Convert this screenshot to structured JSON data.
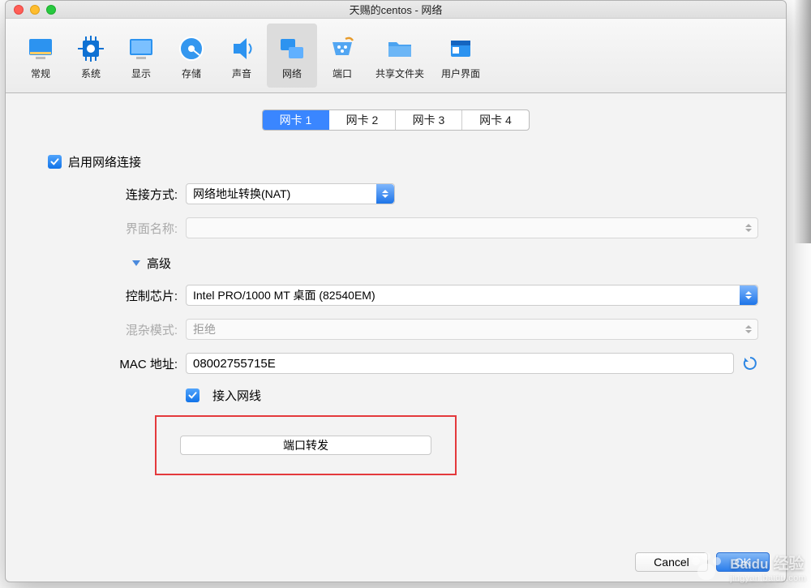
{
  "title": "天赐的centos - 网络",
  "toolbar": {
    "items": [
      {
        "label": "常规",
        "icon": "monitor-orange"
      },
      {
        "label": "系统",
        "icon": "chip"
      },
      {
        "label": "显示",
        "icon": "display"
      },
      {
        "label": "存储",
        "icon": "disk"
      },
      {
        "label": "声音",
        "icon": "speaker"
      },
      {
        "label": "网络",
        "icon": "network",
        "active": true
      },
      {
        "label": "端口",
        "icon": "serial"
      },
      {
        "label": "共享文件夹",
        "icon": "folder"
      },
      {
        "label": "用户界面",
        "icon": "ui"
      }
    ]
  },
  "tabs": [
    "网卡 1",
    "网卡 2",
    "网卡 3",
    "网卡 4"
  ],
  "active_tab": 0,
  "enable_label": "启用网络连接",
  "form": {
    "conn_label": "连接方式:",
    "conn_value": "网络地址转换(NAT)",
    "iface_label": "界面名称:",
    "iface_value": "",
    "advanced_label": "高级",
    "chip_label": "控制芯片:",
    "chip_value": "Intel PRO/1000 MT 桌面 (82540EM)",
    "promisc_label": "混杂模式:",
    "promisc_value": "拒绝",
    "mac_label": "MAC 地址:",
    "mac_value": "08002755715E",
    "cable_label": "接入网线",
    "pf_label": "端口转发"
  },
  "buttons": {
    "cancel": "Cancel",
    "ok": "OK"
  },
  "watermark": {
    "brand": "Baidu",
    "cn": "经验",
    "url": "jingyan.baidu.com"
  }
}
